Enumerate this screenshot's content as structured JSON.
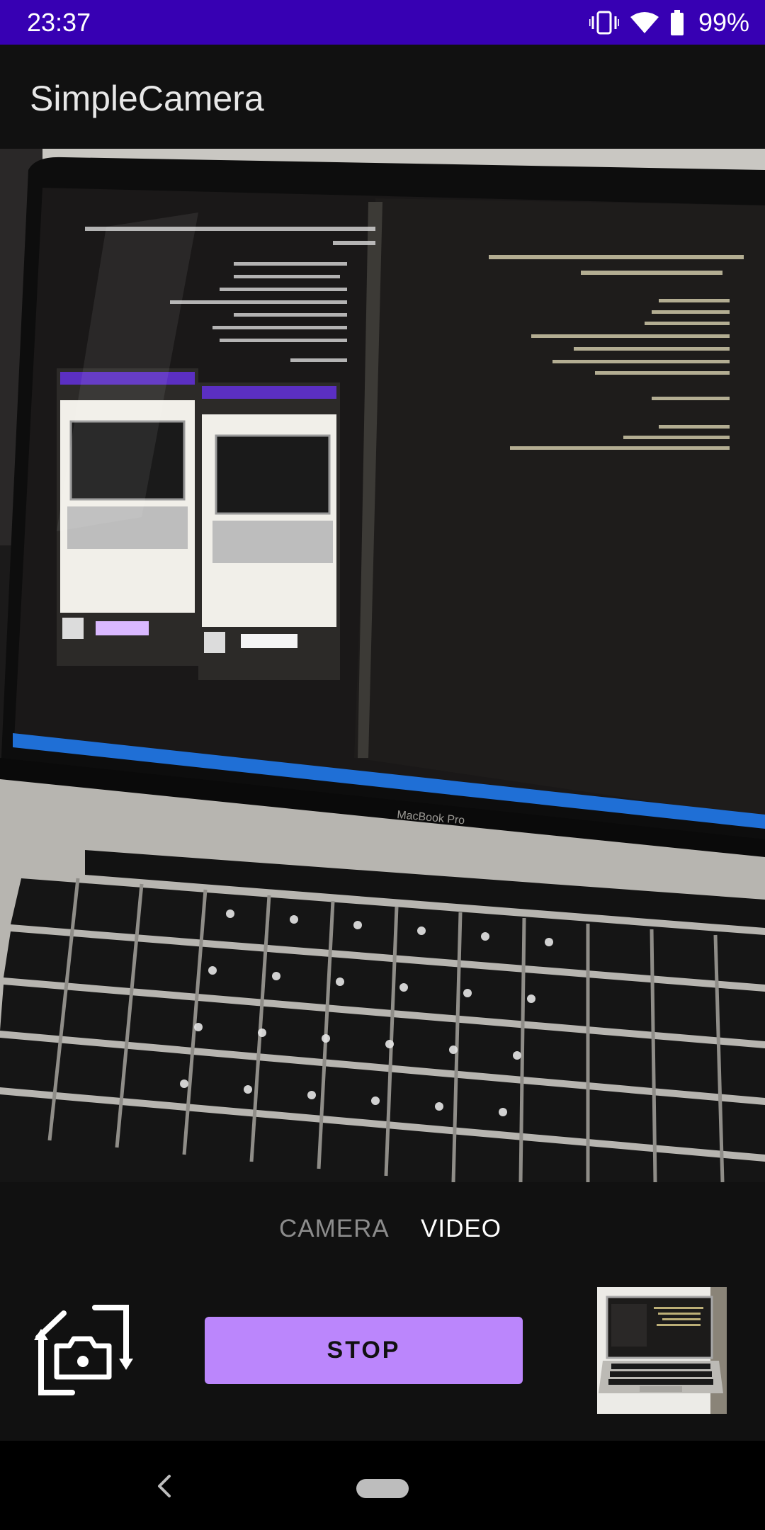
{
  "status_bar": {
    "time": "23:37",
    "battery": "99%",
    "icons": [
      "vibrate-icon",
      "wifi-icon",
      "battery-icon"
    ]
  },
  "app_bar": {
    "title": "SimpleCamera"
  },
  "viewfinder": {
    "laptop_label": "MacBook Pro"
  },
  "mode_tabs": {
    "camera_label": "CAMERA",
    "video_label": "VIDEO",
    "active": "VIDEO"
  },
  "controls": {
    "stop_label": "STOP",
    "switch_icon": "switch-camera-icon",
    "thumbnail_icon": "thumbnail-image"
  },
  "nav_bar": {
    "icons": [
      "back-icon",
      "home-pill"
    ]
  },
  "colors": {
    "status_bar": "#3700b3",
    "accent": "#bb86fc",
    "background": "#111111",
    "active_tab": "#ffffff",
    "inactive_tab": "#8c8c8c"
  }
}
